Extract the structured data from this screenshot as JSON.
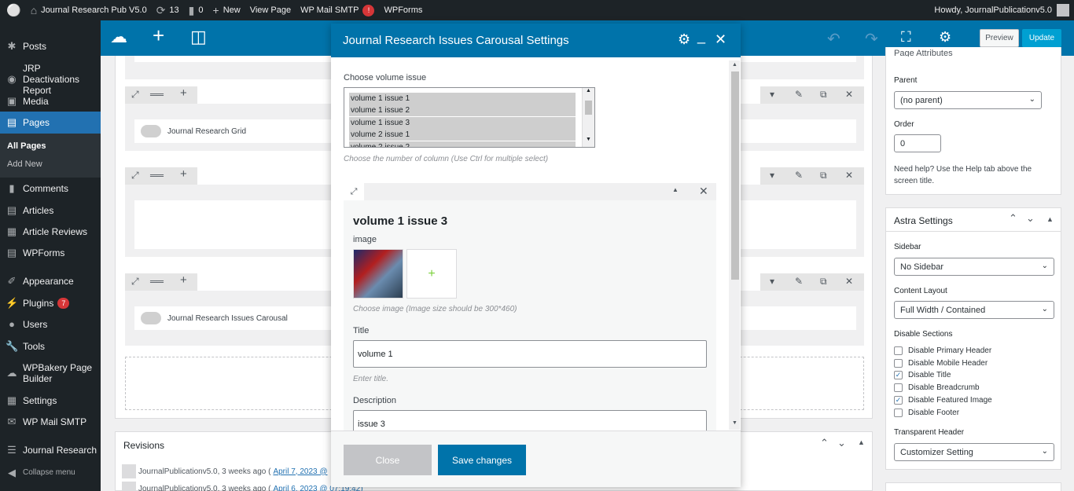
{
  "adminbar": {
    "site_name": "Journal Research Pub V5.0",
    "updates_count": "13",
    "comments_count": "0",
    "new_label": "New",
    "view_page": "View Page",
    "smtp_label": "WP Mail SMTP",
    "smtp_badge": "!",
    "wpforms": "WPForms",
    "howdy": "Howdy, JournalPublicationv5.0"
  },
  "sidebar": {
    "items": [
      {
        "label": "Posts",
        "icon": "pin-icon"
      },
      {
        "label": "JRP Deactivations Report",
        "icon": "globe-icon"
      },
      {
        "label": "Media",
        "icon": "media-icon"
      },
      {
        "label": "Pages",
        "icon": "pages-icon"
      },
      {
        "label": "Comments",
        "icon": "comment-icon"
      },
      {
        "label": "Articles",
        "icon": "articles-icon"
      },
      {
        "label": "Article Reviews",
        "icon": "reviews-icon"
      },
      {
        "label": "WPForms",
        "icon": "forms-icon"
      },
      {
        "label": "Appearance",
        "icon": "brush-icon"
      },
      {
        "label": "Plugins",
        "icon": "plugin-icon",
        "badge": "7"
      },
      {
        "label": "Users",
        "icon": "user-icon"
      },
      {
        "label": "Tools",
        "icon": "wrench-icon"
      },
      {
        "label": "WPBakery Page Builder",
        "icon": "cloud-icon"
      },
      {
        "label": "Settings",
        "icon": "settings-icon"
      },
      {
        "label": "WP Mail SMTP",
        "icon": "mail-icon"
      },
      {
        "label": "Journal Research",
        "icon": "list-icon"
      },
      {
        "label": "Collapse menu",
        "icon": "collapse-icon"
      }
    ],
    "submenu": [
      "All Pages",
      "Add New"
    ]
  },
  "toolbar": {
    "preview": "Preview",
    "update": "Update"
  },
  "canvas": {
    "elements": [
      "Journal Research Grid",
      "Journal Research Issues Carousal"
    ]
  },
  "revisions": {
    "title": "Revisions",
    "rows": [
      {
        "author": "JournalPublicationv5.0, 3 weeks ago (",
        "link": "April 7, 2023 @"
      },
      {
        "author": "JournalPublicationv5.0, 3 weeks ago (",
        "link": "April 6, 2023 @ 07:19:42)"
      }
    ]
  },
  "page_attributes": {
    "title": "Page Attributes",
    "parent_label": "Parent",
    "parent_value": "(no parent)",
    "order_label": "Order",
    "order_value": "0",
    "help": "Need help? Use the Help tab above the screen title."
  },
  "astra": {
    "title": "Astra Settings",
    "sidebar_label": "Sidebar",
    "sidebar_value": "No Sidebar",
    "layout_label": "Content Layout",
    "layout_value": "Full Width / Contained",
    "disable_label": "Disable Sections",
    "checkboxes": [
      {
        "label": "Disable Primary Header",
        "checked": false
      },
      {
        "label": "Disable Mobile Header",
        "checked": false
      },
      {
        "label": "Disable Title",
        "checked": true
      },
      {
        "label": "Disable Breadcrumb",
        "checked": false
      },
      {
        "label": "Disable Featured Image",
        "checked": true
      },
      {
        "label": "Disable Footer",
        "checked": false
      }
    ],
    "transparent_label": "Transparent Header",
    "transparent_value": "Customizer Setting"
  },
  "modal": {
    "title": "Journal Research Issues Carousal Settings",
    "volume_label": "Choose volume issue",
    "volume_options": [
      "volume 1 issue 1",
      "volume 1 issue 2",
      "volume 1 issue 3",
      "volume 2 issue 1",
      "volume 2 issue 2"
    ],
    "volume_hint": "Choose the number of column (Use Ctrl for multiple select)",
    "param": {
      "heading": "volume 1 issue 3",
      "image_label": "image",
      "image_hint": "Choose image (Image size should be 300*460)",
      "title_label": "Title",
      "title_value": "volume 1",
      "title_hint": "Enter title.",
      "desc_label": "Description",
      "desc_value": "issue 3"
    },
    "close_label": "Close",
    "save_label": "Save changes"
  },
  "colors": {
    "accent": "#0073aa",
    "admin_dark": "#1d2327",
    "active_menu": "#2271b1",
    "update_btn": "#00a0d2"
  }
}
